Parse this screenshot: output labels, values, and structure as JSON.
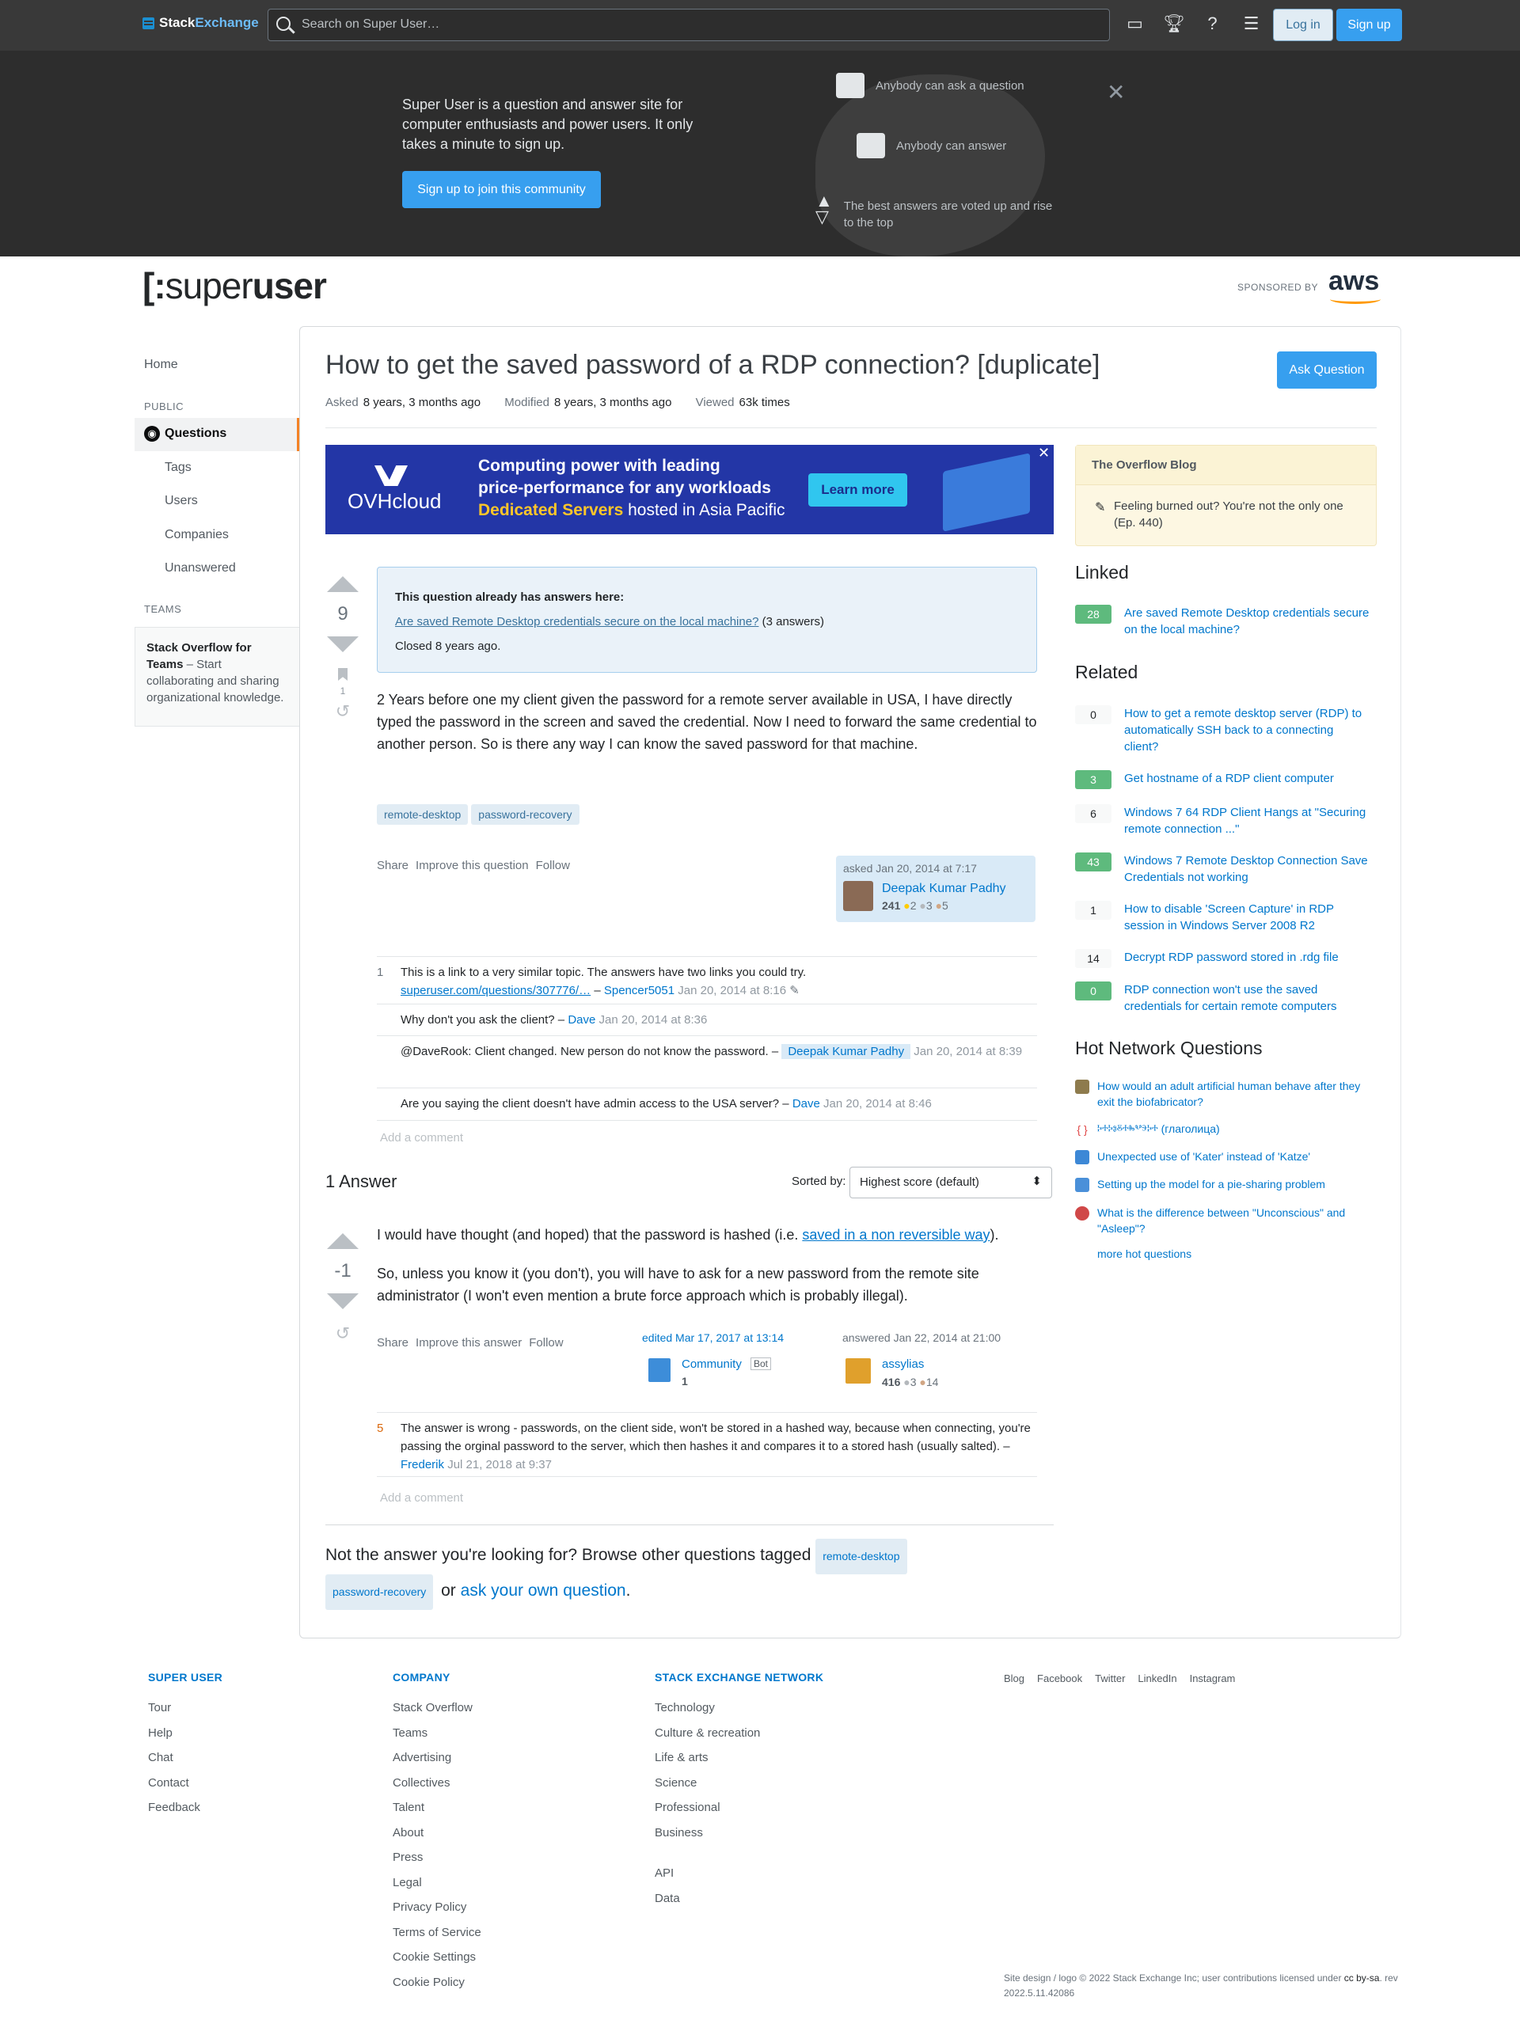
{
  "topbar": {
    "brand_a": "Stack",
    "brand_b": "Exchange",
    "search_placeholder": "Search on Super User…",
    "login": "Log in",
    "signup": "Sign up"
  },
  "hero": {
    "text": "Super User is a question and answer site for computer enthusiasts and power users. It only takes a minute to sign up.",
    "button": "Sign up to join this community",
    "item1": "Anybody can ask a question",
    "item2": "Anybody can answer",
    "item3": "The best answers are voted up and rise to the top"
  },
  "site": {
    "name_a": "super",
    "name_b": "user",
    "sponsored": "SPONSORED BY",
    "sponsor": "aws"
  },
  "nav": {
    "home": "Home",
    "public": "PUBLIC",
    "questions": "Questions",
    "tags": "Tags",
    "users": "Users",
    "companies": "Companies",
    "unanswered": "Unanswered",
    "teams": "TEAMS",
    "teams_box_title": "Stack Overflow for Teams",
    "teams_box_text": " – Start collaborating and sharing organizational knowledge."
  },
  "question": {
    "title": "How to get the saved password of a RDP connection? [duplicate]",
    "ask_button": "Ask Question",
    "asked_label": "Asked",
    "asked": "8 years, 3 months ago",
    "modified_label": "Modified",
    "modified": "8 years, 3 months ago",
    "viewed_label": "Viewed",
    "viewed": "63k times",
    "votes": "9",
    "bookmarks": "1",
    "notice_title": "This question already has answers here:",
    "notice_link": "Are saved Remote Desktop credentials secure on the local machine?",
    "notice_count": "(3 answers)",
    "notice_closed": "Closed 8 years ago.",
    "body": "2 Years before one my client given the password for a remote server available in USA, I have directly typed the password in the screen and saved the credential. Now I need to forward the same credential to another person. So is there any way I can know the saved password for that machine.",
    "tags": [
      "remote-desktop",
      "password-recovery"
    ],
    "menu": [
      "Share",
      "Improve this question",
      "Follow"
    ],
    "asked_by": "asked Jan 20, 2014 at 7:17",
    "user": "Deepak Kumar Padhy",
    "rep": "241",
    "gold": "2",
    "silver": "3",
    "bronze": "5"
  },
  "comments": [
    {
      "score": "1",
      "text": "This is a link to a very similar topic. The answers have two links you could try. ",
      "link": "superuser.com/questions/307776/…",
      "user": "Spencer5051",
      "date": "Jan 20, 2014 at 8:16"
    },
    {
      "score": "",
      "text": "Why don't you ask the client? – ",
      "user": "Dave",
      "date": "Jan 20, 2014 at 8:36"
    },
    {
      "score": "",
      "text": "@DaveRook: Client changed. New person do not know the password. – ",
      "user": "Deepak Kumar Padhy",
      "date": "Jan 20, 2014 at 8:39"
    },
    {
      "score": "",
      "text": "Are you saying the client doesn't have admin access to the USA server? – ",
      "user": "Dave",
      "date": "Jan 20, 2014 at 8:46"
    }
  ],
  "add_comment": "Add a comment",
  "answers": {
    "header": "1 Answer",
    "sorted_by": "Sorted by:",
    "sort_value": "Highest score (default)",
    "votes": "-1",
    "p1a": "I would have thought (and hoped) that the password is hashed (i.e. ",
    "p1link": "saved in a non reversible way",
    "p1b": ").",
    "p2": "So, unless you know it (you don't), you will have to ask for a new password from the remote site administrator (I won't even mention a brute force approach which is probably illegal).",
    "menu": [
      "Share",
      "Improve this answer",
      "Follow"
    ],
    "edited": "edited Mar 17, 2017 at 13:14",
    "editor": "Community",
    "editor_badge": "Bot",
    "editor_rep": "1",
    "answered": "answered Jan 22, 2014 at 21:00",
    "author": "assylias",
    "author_rep": "416",
    "author_silver": "3",
    "author_bronze": "14",
    "comment_score": "5",
    "comment_text": "The answer is wrong - passwords, on the client side, won't be stored in a hashed way, because when connecting, you're passing the orginal password to the server, which then hashes it and compares it to a stored hash (usually salted). – ",
    "comment_user": "Frederik",
    "comment_date": "Jul 21, 2018 at 9:37"
  },
  "not_answer": {
    "text": "Not the answer you're looking for? Browse other questions tagged",
    "tag1": "remote-desktop",
    "tag2": "password-recovery",
    "or": "or",
    "ask": "ask your own question",
    "end": "."
  },
  "ad": {
    "brand": "OVHcloud",
    "line1": "Computing power with leading",
    "line2": "price-performance for any workloads",
    "line3a": "Dedicated Servers",
    "line3b": " hosted in Asia Pacific",
    "cta": "Learn more"
  },
  "sidebar": {
    "blog_title": "The Overflow Blog",
    "blog_item": "Feeling burned out? You're not the only one (Ep. 440)",
    "linked": "Linked",
    "linked_items": [
      {
        "score": "28",
        "title": "Are saved Remote Desktop credentials secure on the local machine?"
      }
    ],
    "related": "Related",
    "related_items": [
      {
        "score": "0",
        "title": "How to get a remote desktop server (RDP) to automatically SSH back to a connecting client?"
      },
      {
        "score": "3",
        "title": "Get hostname of a RDP client computer"
      },
      {
        "score": "6",
        "title": "Windows 7 64 RDP Client Hangs at \"Securing remote connection ...\""
      },
      {
        "score": "43",
        "title": "Windows 7 Remote Desktop Connection Save Credentials not working"
      },
      {
        "score": "1",
        "title": "How to disable 'Screen Capture' in RDP session in Windows Server 2008 R2"
      },
      {
        "score": "14",
        "title": "Decrypt RDP password stored in .rdg file"
      },
      {
        "score": "0",
        "title": "RDP connection won't use the saved credentials for certain remote computers"
      }
    ],
    "hot": "Hot Network Questions",
    "hot_items": [
      {
        "title": "How would an adult artificial human behave after they exit the biofabricator?",
        "color": "#8e7b4d"
      },
      {
        "title": "ⰽⰰⰽⱁⰻⰰⰸⰲⰵⰽⰰ (глаголица)",
        "color": "#e04848"
      },
      {
        "title": "Unexpected use of 'Kater' instead of 'Katze'",
        "color": "#3d88d6"
      },
      {
        "title": "Setting up the model for a pie-sharing problem",
        "color": "#4a90d9"
      },
      {
        "title": "What is the difference between \"Unconscious\" and \"Asleep\"?",
        "color": "#d04848"
      }
    ],
    "more_hot": "more hot questions"
  },
  "footer": {
    "col1_title": "SUPER USER",
    "col1": [
      "Tour",
      "Help",
      "Chat",
      "Contact",
      "Feedback"
    ],
    "col2_title": "COMPANY",
    "col2": [
      "Stack Overflow",
      "Teams",
      "Advertising",
      "Collectives",
      "Talent",
      "About",
      "Press",
      "Legal",
      "Privacy Policy",
      "Terms of Service",
      "Cookie Settings",
      "Cookie Policy"
    ],
    "col3_title": "STACK EXCHANGE NETWORK",
    "col3": [
      "Technology",
      "Culture & recreation",
      "Life & arts",
      "Science",
      "Professional",
      "Business",
      "",
      "API",
      "Data"
    ],
    "social": [
      "Blog",
      "Facebook",
      "Twitter",
      "LinkedIn",
      "Instagram"
    ],
    "copyright_a": "Site design / logo © 2022 Stack Exchange Inc; user contributions licensed under ",
    "copyright_b": "cc by-sa",
    "copyright_c": ". rev 2022.5.11.42086"
  }
}
